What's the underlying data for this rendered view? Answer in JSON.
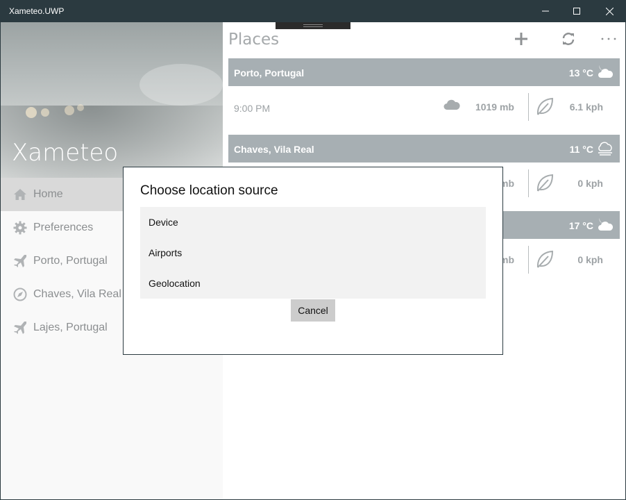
{
  "window": {
    "title": "Xameteo.UWP",
    "minimize_icon": "minimize-icon",
    "maximize_icon": "maximize-icon",
    "close_icon": "close-icon"
  },
  "sidebar": {
    "app_name": "Xameteo",
    "items": [
      {
        "label": "Home",
        "icon": "home-icon",
        "selected": true
      },
      {
        "label": "Preferences",
        "icon": "gear-icon",
        "selected": false
      },
      {
        "label": "Porto, Portugal",
        "icon": "airplane-icon",
        "selected": false
      },
      {
        "label": "Chaves, Vila Real",
        "icon": "compass-icon",
        "selected": false
      },
      {
        "label": "Lajes, Portugal",
        "icon": "airplane-icon",
        "selected": false
      }
    ]
  },
  "main": {
    "title": "Places",
    "commands": {
      "add_icon": "plus-icon",
      "refresh_icon": "refresh-icon",
      "more_icon": "more-icon"
    },
    "places": [
      {
        "name": "Porto, Portugal",
        "temp": "13 °C",
        "weather_icon": "partly-cloudy-night-icon",
        "time": "9:00 PM",
        "pressure": "1019 mb",
        "wind": "6.1 kph"
      },
      {
        "name": "Chaves, Vila Real",
        "temp": "11 °C",
        "weather_icon": "fog-icon",
        "time": "",
        "pressure": "mb",
        "wind": "0 kph"
      },
      {
        "name": "",
        "temp": "17 °C",
        "weather_icon": "partly-cloudy-night-icon",
        "time": "",
        "pressure": "mb",
        "wind": "0 kph"
      }
    ]
  },
  "dialog": {
    "title": "Choose location source",
    "options": [
      "Device",
      "Airports",
      "Geolocation"
    ],
    "cancel_label": "Cancel"
  },
  "colors": {
    "titlebar": "#2b3a40",
    "place_header": "#a7afb3",
    "nav_selected": "#d9d9d9"
  }
}
